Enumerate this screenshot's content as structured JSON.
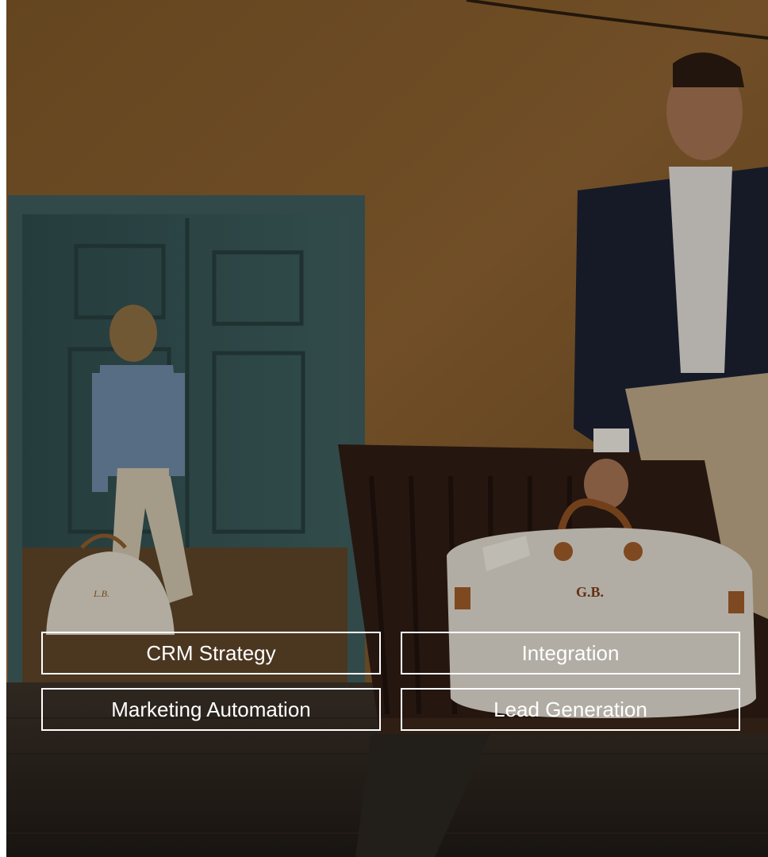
{
  "hero": {
    "image_alt": "Man seated on a wooden bench with a canvas bag monogrammed G.B., woman standing by a teal door holding a bag monogrammed L.B."
  },
  "tags": {
    "crm_strategy": "CRM Strategy",
    "integration": "Integration",
    "marketing_automation": "Marketing Automation",
    "lead_generation": "Lead Generation"
  },
  "photo_text": {
    "bag_left_monogram": "L.B.",
    "bag_right_monogram": "G.B."
  },
  "colors": {
    "tag_border": "#ffffff",
    "tag_text": "#ffffff"
  }
}
